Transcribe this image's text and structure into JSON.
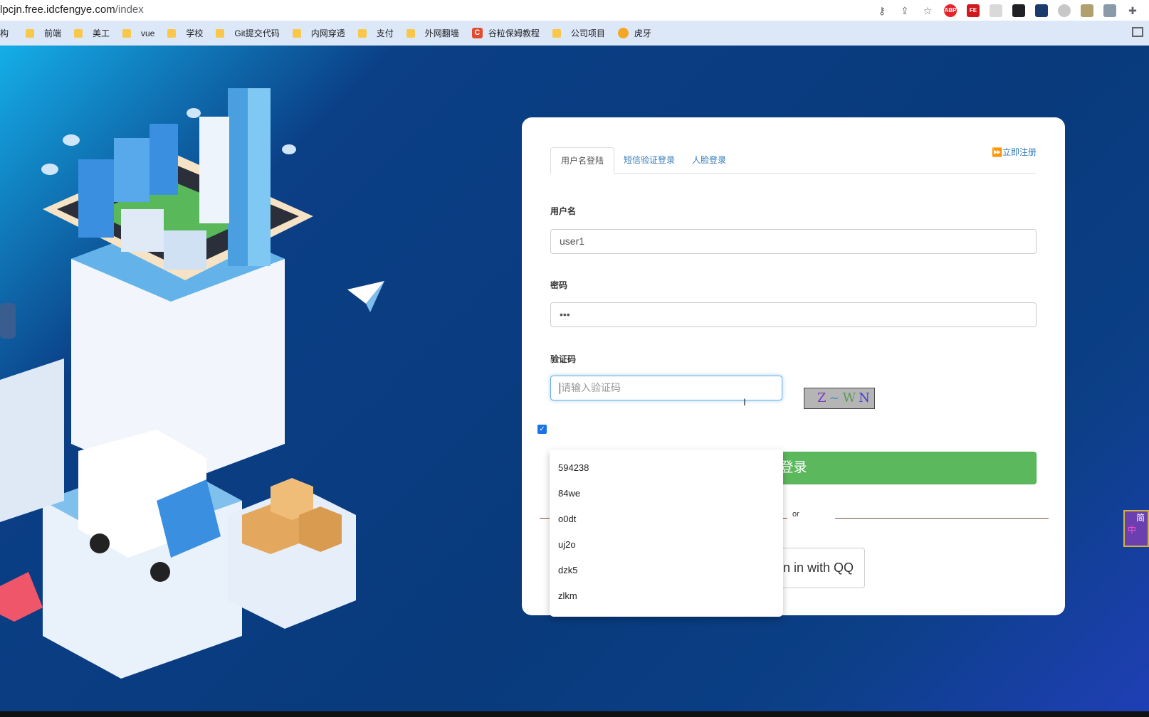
{
  "browser": {
    "url_host": "lpcjn.free.idcfengye.com",
    "url_path": "/index",
    "bookmarks": [
      {
        "label": "构",
        "kind": "text"
      },
      {
        "label": "前端",
        "kind": "folder"
      },
      {
        "label": "美工",
        "kind": "folder"
      },
      {
        "label": "vue",
        "kind": "folder"
      },
      {
        "label": "学校",
        "kind": "folder"
      },
      {
        "label": "Git提交代码",
        "kind": "folder"
      },
      {
        "label": "内网穿透",
        "kind": "folder"
      },
      {
        "label": "支付",
        "kind": "folder"
      },
      {
        "label": "外网翻墙",
        "kind": "folder"
      },
      {
        "label": "谷粒保姆教程",
        "kind": "site-c"
      },
      {
        "label": "公司项目",
        "kind": "folder"
      },
      {
        "label": "虎牙",
        "kind": "site-huya"
      }
    ],
    "extensions": [
      {
        "name": "abp-icon",
        "label": "ABP",
        "color": "#e8222a"
      },
      {
        "name": "fe-icon",
        "label": "FE",
        "color": "#d0191f"
      }
    ]
  },
  "login": {
    "tabs": [
      "用户名登陆",
      "短信验证登录",
      "人脸登录"
    ],
    "register_label": "立即注册",
    "username_label": "用户名",
    "username_value": "user1",
    "password_label": "密码",
    "password_value": "•••",
    "captcha_label": "验证码",
    "captcha_placeholder": "请输入验证码",
    "captcha_chars": [
      "Z",
      "~",
      "W",
      "N"
    ],
    "login_button": "登录",
    "or_text": "or",
    "qq_button": "Sign in with QQ"
  },
  "autocomplete": [
    "594238",
    "84we",
    "o0dt",
    "uj2o",
    "dzk5",
    "zlkm"
  ],
  "ime": {
    "line1": "简",
    "line2": "中"
  }
}
